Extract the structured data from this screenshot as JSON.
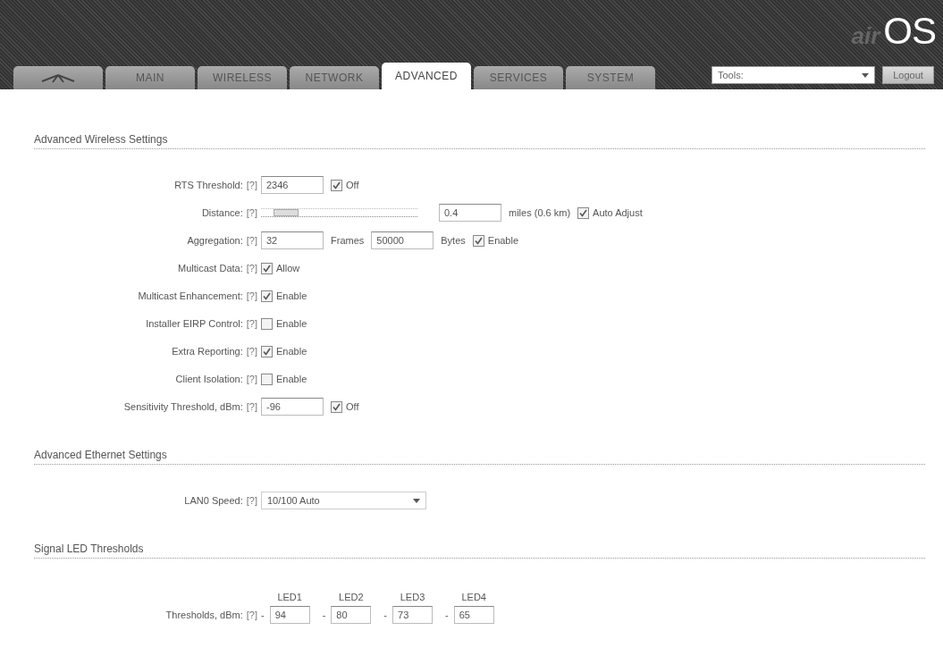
{
  "header": {
    "logo_prefix": "air",
    "logo": "OS"
  },
  "tabs": [
    {
      "kind": "logo",
      "selected": false
    },
    {
      "kind": "text",
      "label": "MAIN",
      "selected": false
    },
    {
      "kind": "text",
      "label": "WIRELESS",
      "selected": false
    },
    {
      "kind": "text",
      "label": "NETWORK",
      "selected": false
    },
    {
      "kind": "text",
      "label": "ADVANCED",
      "selected": true
    },
    {
      "kind": "text",
      "label": "SERVICES",
      "selected": false
    },
    {
      "kind": "text",
      "label": "SYSTEM",
      "selected": false
    }
  ],
  "tools": {
    "value": "Tools:",
    "logout": "Logout"
  },
  "sections": [
    {
      "title": "Advanced Wireless Settings",
      "rows": [
        {
          "kind": "input_check",
          "label": "RTS Threshold:",
          "help": "[?]",
          "value": "2346",
          "check": {
            "checked": true,
            "label": "Off"
          }
        },
        {
          "kind": "slider",
          "label": "Distance:",
          "help": "[?]",
          "level": 0.08,
          "value": "0.4",
          "unit": "miles (0.6 km)",
          "check": {
            "checked": true,
            "label": "Auto Adjust"
          }
        },
        {
          "kind": "aggregation",
          "label": "Aggregation:",
          "help": "[?]",
          "value": "32",
          "unit": "Frames",
          "value_2": "50000",
          "unit_2": "Bytes",
          "check": {
            "checked": true,
            "label": "Enable"
          }
        },
        {
          "kind": "check",
          "label": "Multicast Data:",
          "help": "[?]",
          "check": {
            "checked": true,
            "label": "Allow"
          }
        },
        {
          "kind": "check",
          "label": "Multicast Enhancement:",
          "help": "[?]",
          "check": {
            "checked": true,
            "label": "Enable"
          }
        },
        {
          "kind": "check",
          "label": "Installer EIRP Control:",
          "help": "[?]",
          "check": {
            "checked": false,
            "label": "Enable"
          }
        },
        {
          "kind": "check",
          "label": "Extra Reporting:",
          "help": "[?]",
          "check": {
            "checked": true,
            "label": "Enable"
          }
        },
        {
          "kind": "check",
          "label": "Client Isolation:",
          "help": "[?]",
          "check": {
            "checked": false,
            "label": "Enable"
          }
        },
        {
          "kind": "input_check",
          "label": "Sensitivity Threshold, dBm:",
          "help": "[?]",
          "value": "-96",
          "check": {
            "checked": true,
            "label": "Off"
          }
        }
      ]
    },
    {
      "title": "Advanced Ethernet Settings",
      "rows": [
        {
          "kind": "select",
          "label": "LAN0 Speed:",
          "help": "[?]",
          "value": "10/100 Auto"
        }
      ]
    },
    {
      "title": "Signal LED Thresholds",
      "rows": [
        {
          "kind": "leds",
          "label": "Thresholds, dBm:",
          "help": "[?]",
          "leds": [
            {
              "label": "LED1",
              "sign": "-",
              "value": "94"
            },
            {
              "label": "LED2",
              "sign": "-",
              "value": "80"
            },
            {
              "label": "LED3",
              "sign": "-",
              "value": "73"
            },
            {
              "label": "LED4",
              "sign": "-",
              "value": "65"
            }
          ]
        }
      ]
    }
  ]
}
